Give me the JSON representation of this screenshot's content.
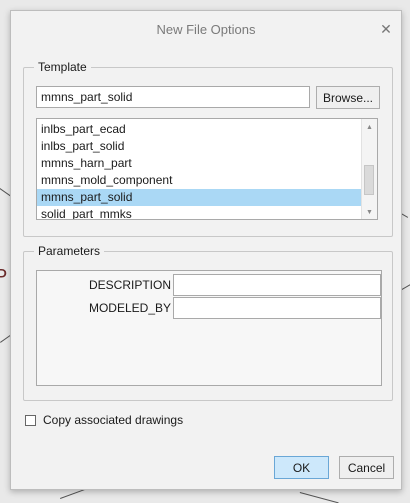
{
  "dialog": {
    "title": "New File Options",
    "close_icon": "close-icon"
  },
  "template": {
    "legend": "Template",
    "input_value": "mmns_part_solid",
    "browse_label": "Browse...",
    "items": [
      "inlbs_part_ecad",
      "inlbs_part_solid",
      "mmns_harn_part",
      "mmns_mold_component",
      "mmns_part_solid",
      "solid_part_mmks"
    ],
    "selected_index": 4
  },
  "parameters": {
    "legend": "Parameters",
    "rows": [
      {
        "label": "DESCRIPTION",
        "value": ""
      },
      {
        "label": "MODELED_BY",
        "value": ""
      }
    ]
  },
  "copy_drawings": {
    "label": "Copy associated drawings",
    "checked": false
  },
  "buttons": {
    "ok_label": "OK",
    "cancel_label": "Cancel"
  },
  "background": {
    "partial_letter": "P"
  },
  "colors": {
    "selection": "#aad8f5",
    "ok_button": "#cde8fb"
  }
}
